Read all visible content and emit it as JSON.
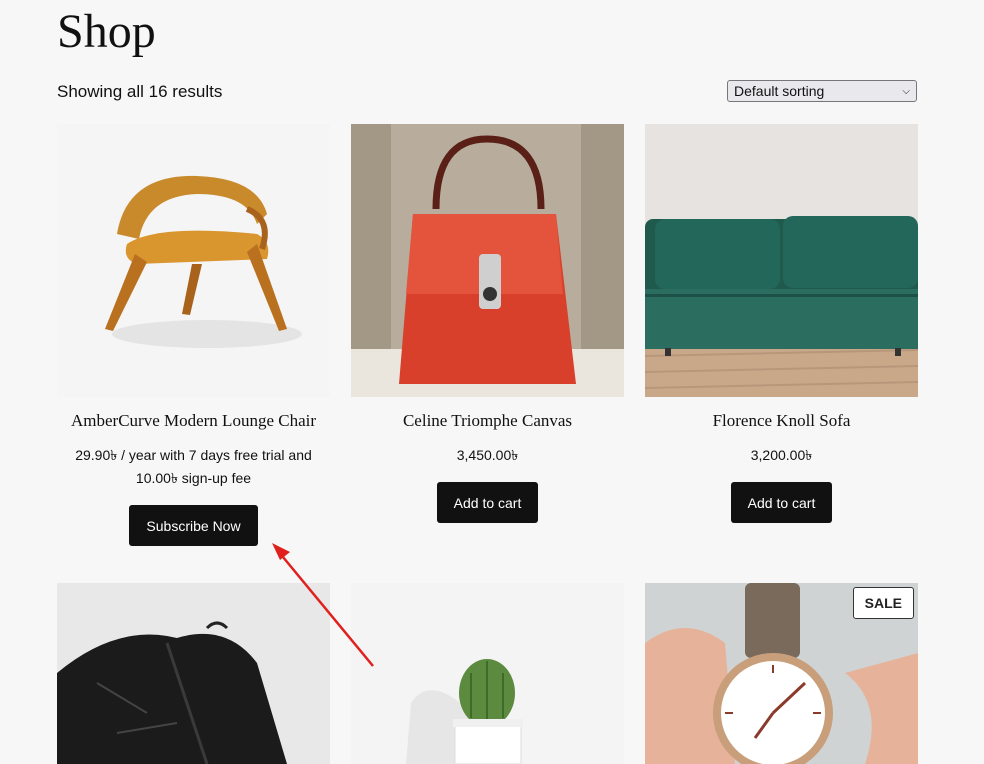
{
  "page": {
    "title": "Shop"
  },
  "toolbar": {
    "result_count": "Showing all 16 results",
    "sort_selected": "Default sorting"
  },
  "products": [
    {
      "name": "AmberCurve Modern Lounge Chair",
      "price_line1": "29.90৳  / year with 7 days free trial and",
      "price_line2": "10.00৳  sign-up fee",
      "button": "Subscribe Now"
    },
    {
      "name": "Celine Triomphe Canvas",
      "price": "3,450.00৳",
      "button": "Add to cart"
    },
    {
      "name": "Florence Knoll Sofa",
      "price": "3,200.00৳",
      "button": "Add to cart"
    },
    {
      "name": ""
    },
    {
      "name": ""
    },
    {
      "name": "",
      "badge": "SALE"
    }
  ],
  "colors": {
    "button_bg": "#111111",
    "annotation_arrow": "#e0201c"
  }
}
